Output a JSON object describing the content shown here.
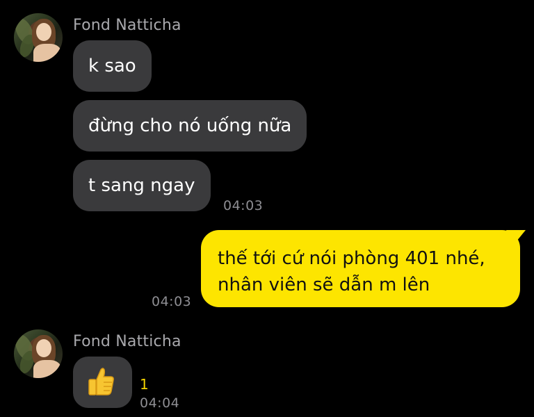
{
  "messages_group_1": {
    "sender": "Fond Natticha",
    "bubbles": [
      "k sao",
      "đừng cho nó uống nữa",
      "t sang ngay"
    ],
    "time": "04:03"
  },
  "outgoing": {
    "lines": [
      "thế tới cứ nói phòng 401 nhé,",
      "nhân viên sẽ dẫn m lên"
    ],
    "time": "04:03"
  },
  "messages_group_2": {
    "sender": "Fond Natticha",
    "emoji_icon": "thumbs-up-icon",
    "reaction_count": "1",
    "time": "04:04"
  },
  "colors": {
    "background": "#000000",
    "incoming_bubble": "#3a3a3c",
    "outgoing_bubble": "#fde500",
    "reaction": "#f5d400"
  }
}
